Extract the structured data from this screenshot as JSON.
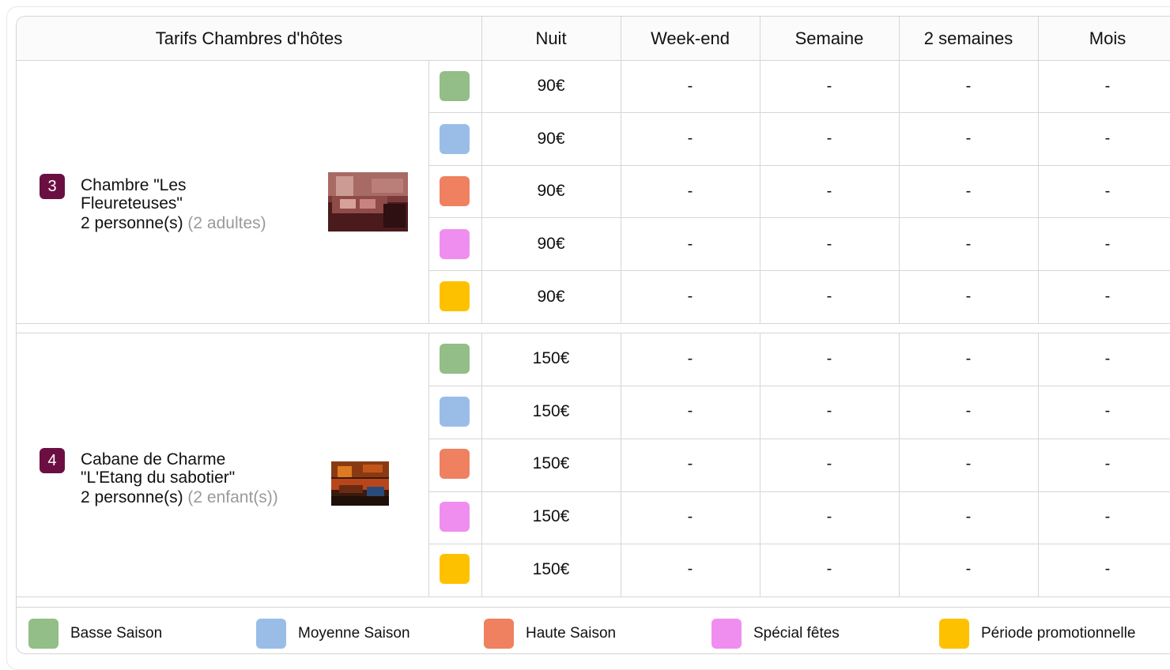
{
  "header": {
    "title": "Tarifs Chambres d'hôtes",
    "columns": [
      "Nuit",
      "Week-end",
      "Semaine",
      "2 semaines",
      "Mois"
    ]
  },
  "colors": {
    "basse": "#93be87",
    "moyenne": "#9abde8",
    "haute": "#ef8060",
    "speciale": "#f08ef0",
    "promo": "#fec100",
    "badge": "#6b0f43"
  },
  "rooms": [
    {
      "number": "3",
      "name_line1": "Chambre \"Les",
      "name_line2": "Fleureteuses\"",
      "capacity": "2 personne(s)",
      "capacity_detail": "(2 adultes)",
      "rates": [
        {
          "season": "basse",
          "nuit": "90€",
          "weekend": "-",
          "semaine": "-",
          "deux_semaines": "-",
          "mois": "-"
        },
        {
          "season": "moyenne",
          "nuit": "90€",
          "weekend": "-",
          "semaine": "-",
          "deux_semaines": "-",
          "mois": "-"
        },
        {
          "season": "haute",
          "nuit": "90€",
          "weekend": "-",
          "semaine": "-",
          "deux_semaines": "-",
          "mois": "-"
        },
        {
          "season": "speciale",
          "nuit": "90€",
          "weekend": "-",
          "semaine": "-",
          "deux_semaines": "-",
          "mois": "-"
        },
        {
          "season": "promo",
          "nuit": "90€",
          "weekend": "-",
          "semaine": "-",
          "deux_semaines": "-",
          "mois": "-"
        }
      ]
    },
    {
      "number": "4",
      "name_line1": "Cabane de Charme",
      "name_line2": "\"L'Etang du sabotier\"",
      "capacity": "2 personne(s)",
      "capacity_detail": "(2 enfant(s))",
      "rates": [
        {
          "season": "basse",
          "nuit": "150€",
          "weekend": "-",
          "semaine": "-",
          "deux_semaines": "-",
          "mois": "-"
        },
        {
          "season": "moyenne",
          "nuit": "150€",
          "weekend": "-",
          "semaine": "-",
          "deux_semaines": "-",
          "mois": "-"
        },
        {
          "season": "haute",
          "nuit": "150€",
          "weekend": "-",
          "semaine": "-",
          "deux_semaines": "-",
          "mois": "-"
        },
        {
          "season": "speciale",
          "nuit": "150€",
          "weekend": "-",
          "semaine": "-",
          "deux_semaines": "-",
          "mois": "-"
        },
        {
          "season": "promo",
          "nuit": "150€",
          "weekend": "-",
          "semaine": "-",
          "deux_semaines": "-",
          "mois": "-"
        }
      ]
    }
  ],
  "legend": [
    {
      "season": "basse",
      "label": "Basse Saison"
    },
    {
      "season": "moyenne",
      "label": "Moyenne Saison"
    },
    {
      "season": "haute",
      "label": "Haute Saison"
    },
    {
      "season": "speciale",
      "label": "Spécial fêtes"
    },
    {
      "season": "promo",
      "label": "Période promotionnelle"
    }
  ]
}
